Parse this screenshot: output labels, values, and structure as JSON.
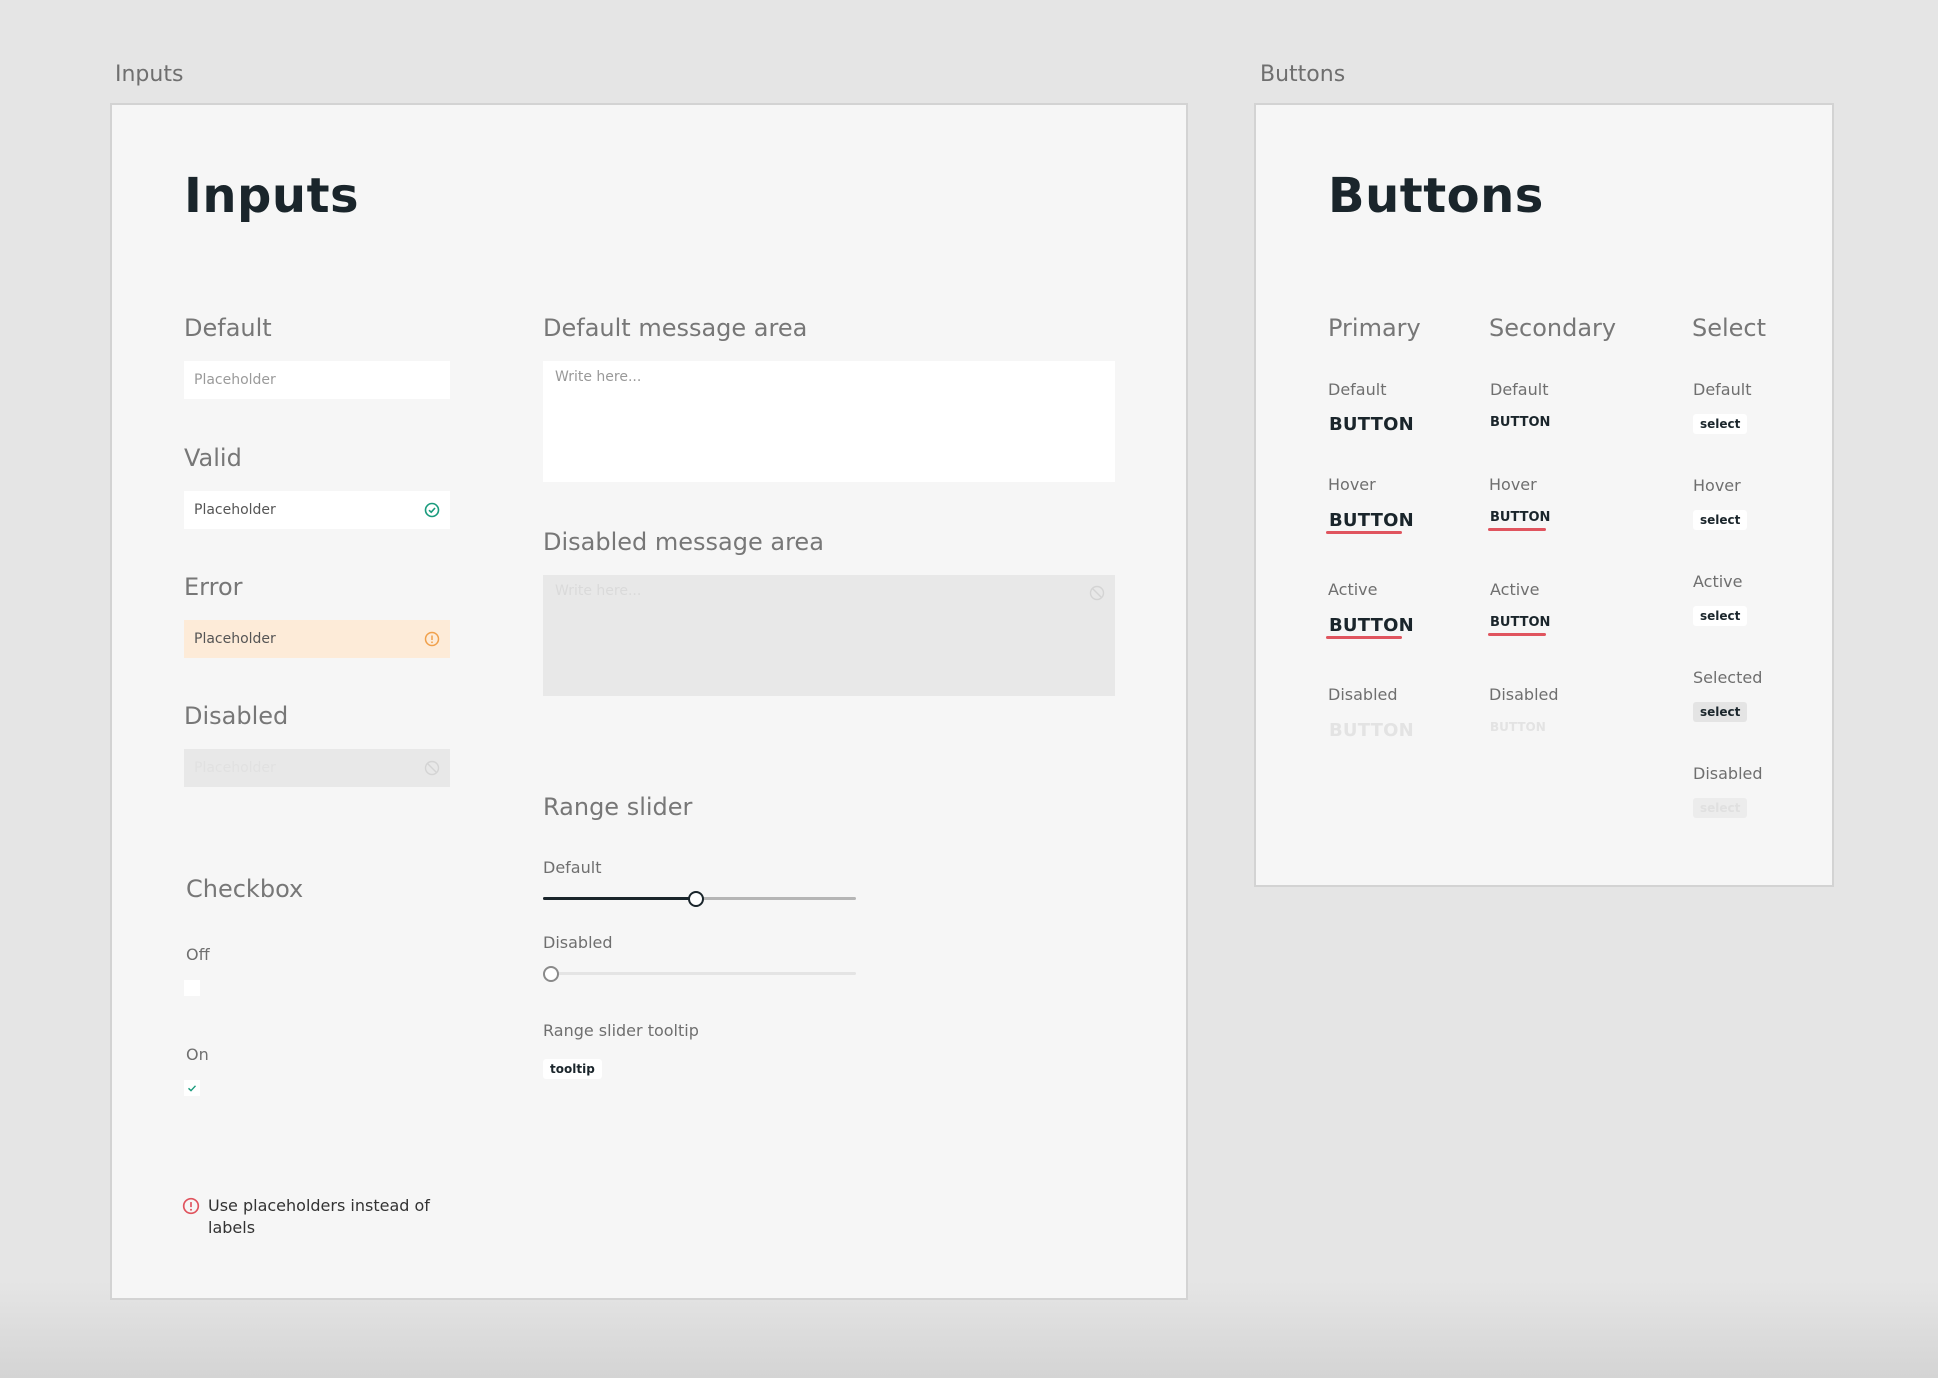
{
  "frames": {
    "inputs_label": "Inputs",
    "buttons_label": "Buttons"
  },
  "inputs": {
    "title": "Inputs",
    "default": {
      "label": "Default",
      "placeholder": "Placeholder"
    },
    "valid": {
      "label": "Valid",
      "placeholder": "Placeholder"
    },
    "error": {
      "label": "Error",
      "placeholder": "Placeholder"
    },
    "disabled": {
      "label": "Disabled",
      "placeholder": "Placeholder"
    },
    "default_area": {
      "label": "Default message area",
      "placeholder": "Write here..."
    },
    "disabled_area": {
      "label": "Disabled message area",
      "placeholder": "Write here..."
    },
    "range": {
      "title": "Range slider",
      "default_label": "Default",
      "default_value": 0.49,
      "disabled_label": "Disabled",
      "disabled_value": 0,
      "tooltip_label": "Range slider tooltip",
      "tooltip_text": "tooltip"
    },
    "checkbox": {
      "title": "Checkbox",
      "off_label": "Off",
      "on_label": "On"
    },
    "note": "Use placeholders instead of labels"
  },
  "buttons": {
    "title": "Buttons",
    "primary": {
      "title": "Primary",
      "states": [
        "Default",
        "Hover",
        "Active",
        "Disabled"
      ],
      "button_text": "BUTTON"
    },
    "secondary": {
      "title": "Secondary",
      "states": [
        "Default",
        "Hover",
        "Active",
        "Disabled"
      ],
      "button_text": "BUTTON"
    },
    "select": {
      "title": "Select",
      "states": [
        "Default",
        "Hover",
        "Active",
        "Selected",
        "Disabled"
      ],
      "chip_text": "select"
    }
  },
  "colors": {
    "valid": "#1a9b7d",
    "error": "#f0a04b",
    "underline": "#e0545e",
    "warning": "#e0545e"
  },
  "icons": [
    "check-circle-icon",
    "error-circle-icon",
    "disabled-circle-icon",
    "check-icon",
    "alert-circle-icon"
  ]
}
